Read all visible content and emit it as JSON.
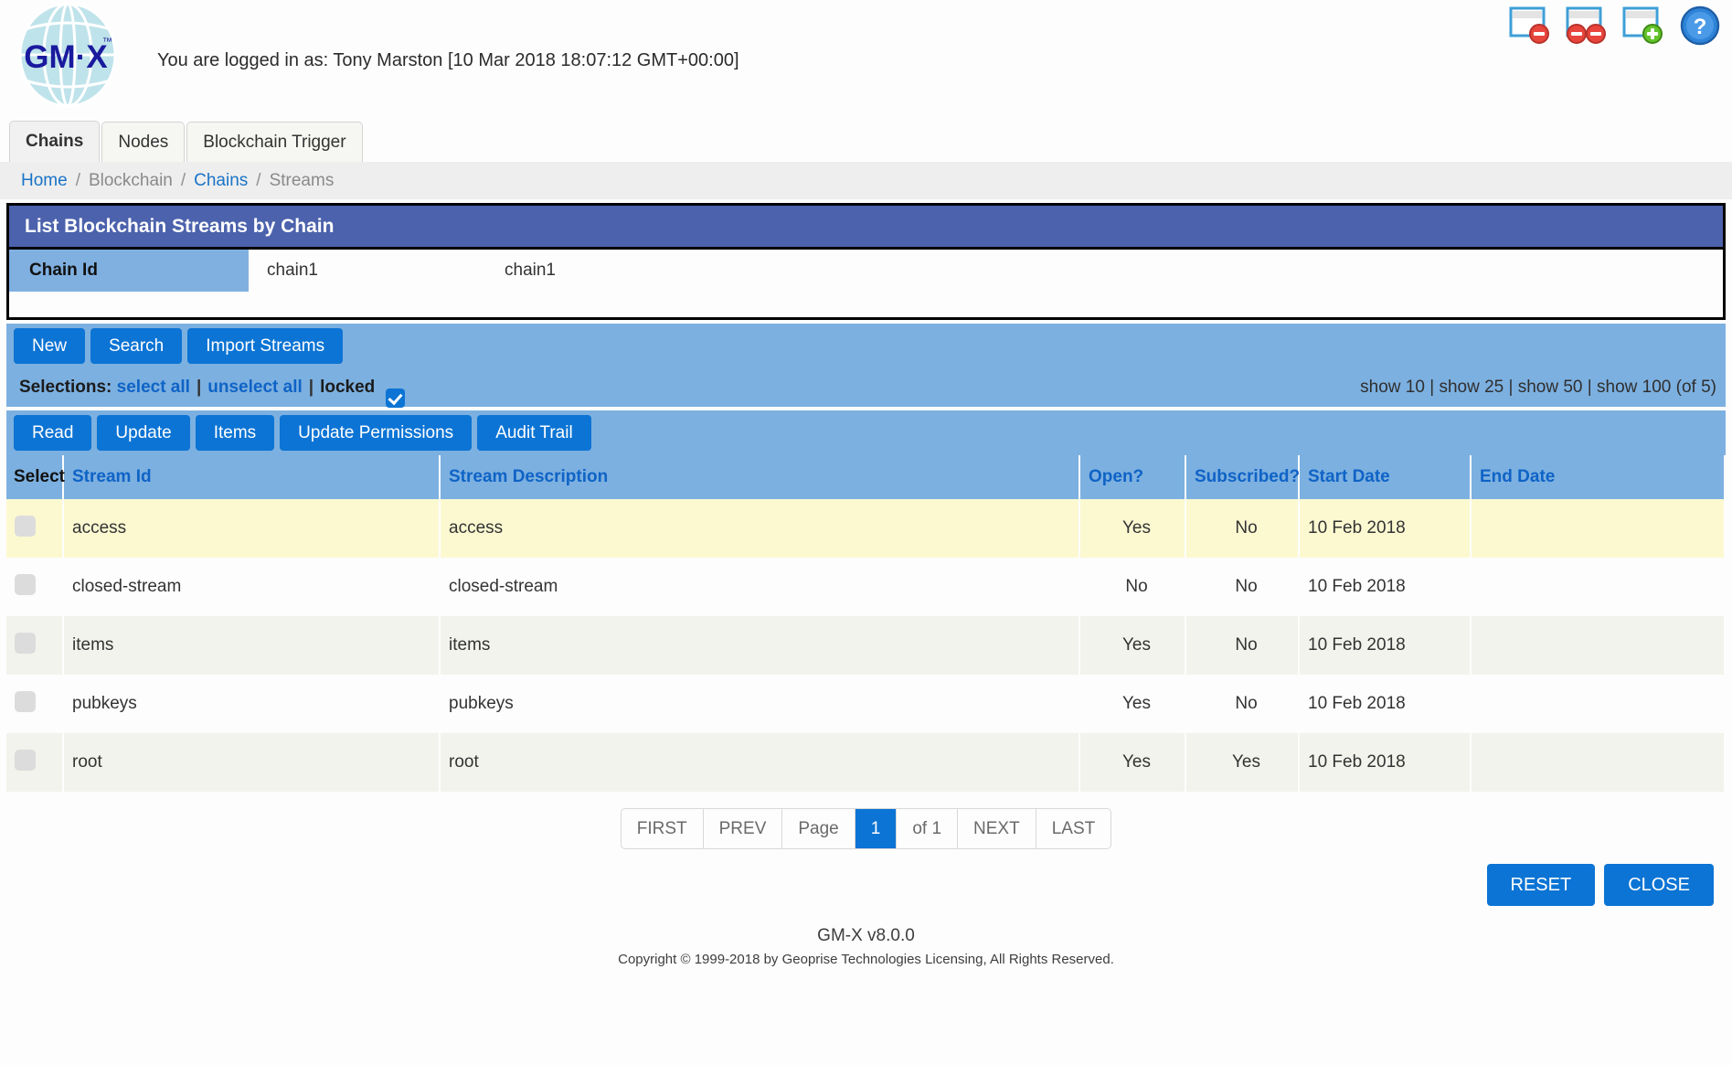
{
  "header": {
    "logo_text": "GM-X",
    "logo_tm": "™",
    "login_text": "You are logged in as: Tony Marston [10 Mar 2018 18:07:12 GMT+00:00]",
    "icons": [
      {
        "name": "close-window-icon",
        "title": "Close Window"
      },
      {
        "name": "close-all-windows-icon",
        "title": "Close All Windows"
      },
      {
        "name": "new-window-icon",
        "title": "New Window"
      },
      {
        "name": "help-icon",
        "title": "Help"
      }
    ]
  },
  "tabs": [
    {
      "label": "Chains",
      "active": true
    },
    {
      "label": "Nodes",
      "active": false
    },
    {
      "label": "Blockchain Trigger",
      "active": false
    }
  ],
  "breadcrumb": [
    {
      "label": "Home",
      "link": true
    },
    {
      "label": "Blockchain",
      "link": false
    },
    {
      "label": "Chains",
      "link": true
    },
    {
      "label": "Streams",
      "link": false
    }
  ],
  "panel": {
    "title": "List Blockchain Streams by Chain",
    "field_label": "Chain Id",
    "field_value_1": "chain1",
    "field_value_2": "chain1"
  },
  "toolbar_top": [
    {
      "label": "New"
    },
    {
      "label": "Search"
    },
    {
      "label": "Import Streams"
    }
  ],
  "selections": {
    "prefix": "Selections:",
    "select_all": "select all",
    "unselect_all": "unselect all",
    "locked": "locked",
    "locked_checked": true,
    "show_options": [
      {
        "label": "show 10"
      },
      {
        "label": "show 25"
      },
      {
        "label": "show 50"
      },
      {
        "label": "show 100"
      }
    ],
    "count_text": "(of 5)"
  },
  "toolbar_actions": [
    {
      "label": "Read"
    },
    {
      "label": "Update"
    },
    {
      "label": "Items"
    },
    {
      "label": "Update Permissions"
    },
    {
      "label": "Audit Trail"
    }
  ],
  "table": {
    "columns": [
      {
        "label": "Select",
        "key": "select"
      },
      {
        "label": "Stream Id",
        "key": "stream_id"
      },
      {
        "label": "Stream Description",
        "key": "stream_desc"
      },
      {
        "label": "Open?",
        "key": "open"
      },
      {
        "label": "Subscribed?",
        "key": "subscribed"
      },
      {
        "label": "Start Date",
        "key": "start_date"
      },
      {
        "label": "End Date",
        "key": "end_date"
      }
    ],
    "rows": [
      {
        "stream_id": "access",
        "stream_desc": "access",
        "open": "Yes",
        "subscribed": "No",
        "start_date": "10 Feb 2018",
        "end_date": "",
        "style": "r-hl"
      },
      {
        "stream_id": "closed-stream",
        "stream_desc": "closed-stream",
        "open": "No",
        "subscribed": "No",
        "start_date": "10 Feb 2018",
        "end_date": "",
        "style": "r-white"
      },
      {
        "stream_id": "items",
        "stream_desc": "items",
        "open": "Yes",
        "subscribed": "No",
        "start_date": "10 Feb 2018",
        "end_date": "",
        "style": "r-grey"
      },
      {
        "stream_id": "pubkeys",
        "stream_desc": "pubkeys",
        "open": "Yes",
        "subscribed": "No",
        "start_date": "10 Feb 2018",
        "end_date": "",
        "style": "r-white"
      },
      {
        "stream_id": "root",
        "stream_desc": "root",
        "open": "Yes",
        "subscribed": "Yes",
        "start_date": "10 Feb 2018",
        "end_date": "",
        "style": "r-grey"
      }
    ]
  },
  "pagination": {
    "first": "FIRST",
    "prev": "PREV",
    "page_label": "Page",
    "current_page": "1",
    "of_label": "of 1",
    "next": "NEXT",
    "last": "LAST"
  },
  "footer_buttons": [
    {
      "label": "RESET"
    },
    {
      "label": "CLOSE"
    }
  ],
  "footer": {
    "version": "GM-X v8.0.0",
    "copyright": "Copyright © 1999-2018 by Geoprise Technologies Licensing, All Rights Reserved."
  },
  "colors": {
    "panel_title_bg": "#4c62ac",
    "accent_blue": "#0c74d4",
    "bar_blue": "#7cb0e0",
    "field_label_bg": "#80b0e0",
    "link_blue": "#0f63c6",
    "row_highlight": "#fcf9d1",
    "row_alt": "#f2f3ec"
  }
}
